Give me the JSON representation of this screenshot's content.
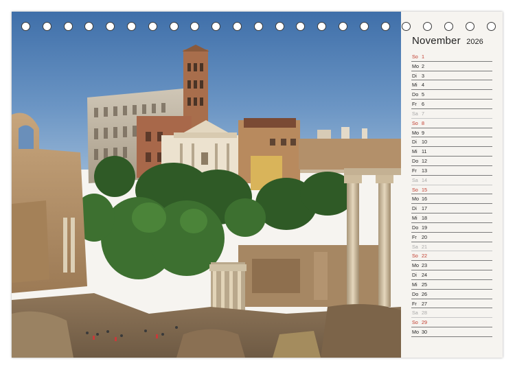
{
  "calendar": {
    "month": "November",
    "year": "2026",
    "days": [
      {
        "wd": "So",
        "num": "1",
        "type": "sun"
      },
      {
        "wd": "Mo",
        "num": "2",
        "type": "week"
      },
      {
        "wd": "Di",
        "num": "3",
        "type": "week"
      },
      {
        "wd": "Mi",
        "num": "4",
        "type": "week"
      },
      {
        "wd": "Do",
        "num": "5",
        "type": "week"
      },
      {
        "wd": "Fr",
        "num": "6",
        "type": "week"
      },
      {
        "wd": "Sa",
        "num": "7",
        "type": "sat"
      },
      {
        "wd": "So",
        "num": "8",
        "type": "sun"
      },
      {
        "wd": "Mo",
        "num": "9",
        "type": "week"
      },
      {
        "wd": "Di",
        "num": "10",
        "type": "week"
      },
      {
        "wd": "Mi",
        "num": "11",
        "type": "week"
      },
      {
        "wd": "Do",
        "num": "12",
        "type": "week"
      },
      {
        "wd": "Fr",
        "num": "13",
        "type": "week"
      },
      {
        "wd": "Sa",
        "num": "14",
        "type": "sat"
      },
      {
        "wd": "So",
        "num": "15",
        "type": "sun"
      },
      {
        "wd": "Mo",
        "num": "16",
        "type": "week"
      },
      {
        "wd": "Di",
        "num": "17",
        "type": "week"
      },
      {
        "wd": "Mi",
        "num": "18",
        "type": "week"
      },
      {
        "wd": "Do",
        "num": "19",
        "type": "week"
      },
      {
        "wd": "Fr",
        "num": "20",
        "type": "week"
      },
      {
        "wd": "Sa",
        "num": "21",
        "type": "sat"
      },
      {
        "wd": "So",
        "num": "22",
        "type": "sun"
      },
      {
        "wd": "Mo",
        "num": "23",
        "type": "week"
      },
      {
        "wd": "Di",
        "num": "24",
        "type": "week"
      },
      {
        "wd": "Mi",
        "num": "25",
        "type": "week"
      },
      {
        "wd": "Do",
        "num": "26",
        "type": "week"
      },
      {
        "wd": "Fr",
        "num": "27",
        "type": "week"
      },
      {
        "wd": "Sa",
        "num": "28",
        "type": "sat"
      },
      {
        "wd": "So",
        "num": "29",
        "type": "sun"
      },
      {
        "wd": "Mo",
        "num": "30",
        "type": "week"
      }
    ]
  },
  "colors": {
    "sunday": "#c0392b",
    "saturday": "#a8a8a8",
    "weekday": "#222222"
  }
}
